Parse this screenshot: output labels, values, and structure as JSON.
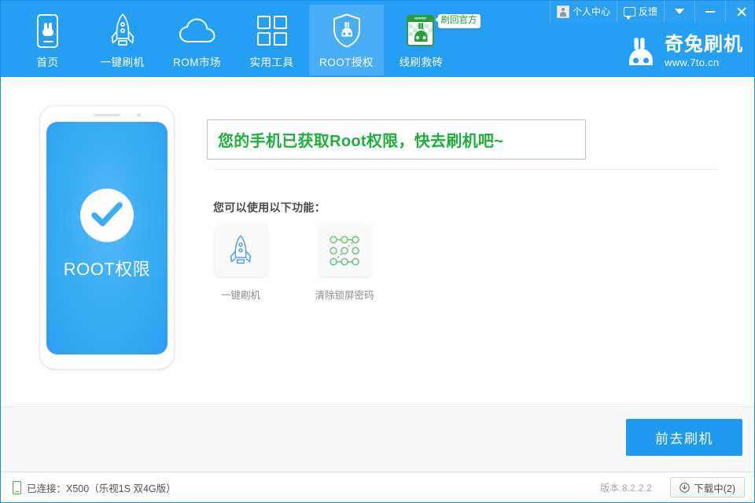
{
  "window": {
    "titlebar": {
      "user_center_label": "个人中心",
      "user_center_icon": "avatar-icon",
      "feedback_label": "反馈",
      "feedback_icon": "speech-bubble-icon",
      "dropdown_icon": "chevron-down-icon",
      "minimize_icon": "minimize-icon",
      "close_icon": "close-icon"
    },
    "brand": {
      "name": "奇兔刷机",
      "url": "www.7to.cn",
      "logo_icon": "rabbit-logo-icon"
    },
    "accent_color": "#249ff3",
    "active_nav_color": "#48aff6"
  },
  "nav": {
    "items": [
      {
        "label": "首页",
        "icon": "phone-home-icon",
        "active": false
      },
      {
        "label": "一键刷机",
        "icon": "rocket-icon",
        "active": false
      },
      {
        "label": "ROM市场",
        "icon": "cloud-icon",
        "active": false
      },
      {
        "label": "实用工具",
        "icon": "grid-tools-icon",
        "active": false
      },
      {
        "label": "ROOT授权",
        "icon": "shield-rabbit-icon",
        "active": true
      },
      {
        "label": "线刷救砖",
        "icon": "brick-rescue-icon",
        "active": false,
        "badge": "刷回官方"
      }
    ]
  },
  "phone_preview": {
    "status_icon": "check-circle-icon",
    "title": "ROOT权限"
  },
  "main": {
    "banner": {
      "text": "您的手机已获取Root权限，快去刷机吧~",
      "text_color": "#1caf3c",
      "border_color": "#eeadad"
    },
    "section_title": "您可以使用以下功能：",
    "feature_cards": [
      {
        "label": "一键刷机",
        "icon": "rocket-icon"
      },
      {
        "label": "清除锁屏密码",
        "icon": "pattern-lock-icon"
      }
    ]
  },
  "action_bar": {
    "primary_button": "前去刷机"
  },
  "status_bar": {
    "device_icon": "phone-icon",
    "connection": "已连接：X500（乐视1S 双4G版）",
    "version": "版本:8.2.2.2",
    "download_button": "下载中(2)",
    "download_icon": "download-icon"
  }
}
